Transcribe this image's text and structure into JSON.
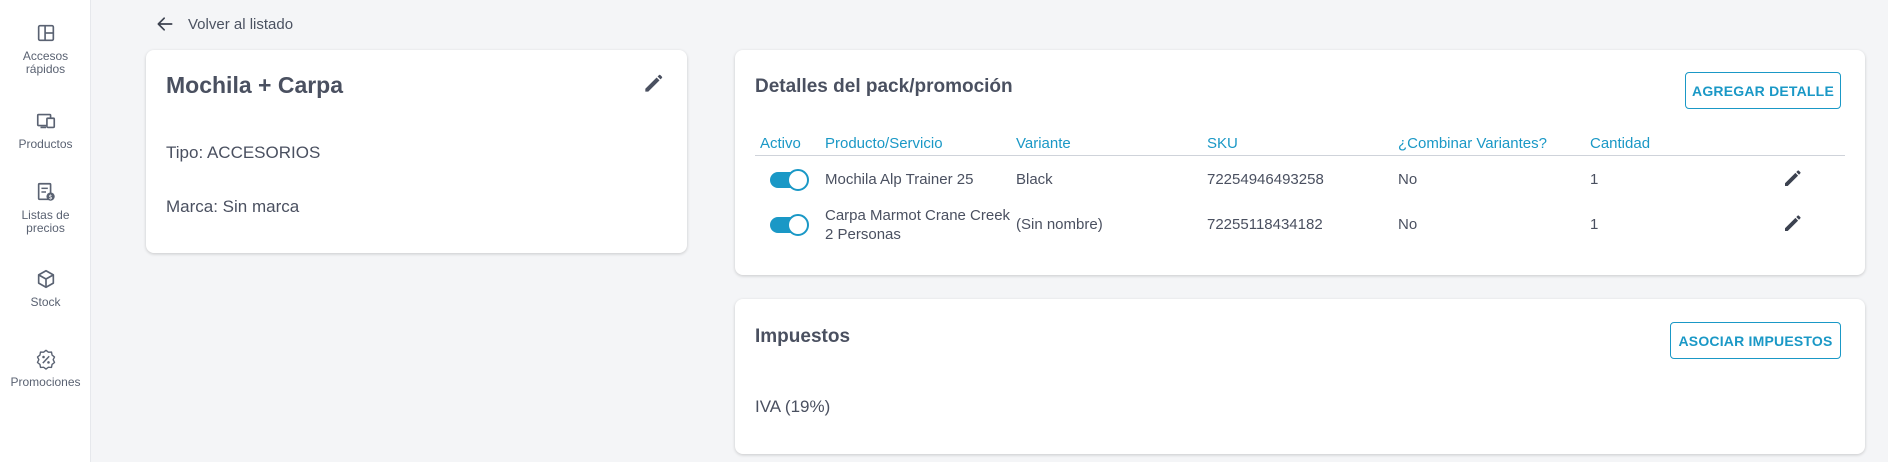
{
  "sidebar": {
    "items": [
      {
        "label_lines": [
          "Accesos",
          "rápidos"
        ],
        "icon": "dashboard-icon"
      },
      {
        "label_lines": [
          "Productos"
        ],
        "icon": "devices-icon"
      },
      {
        "label_lines": [
          "Listas de",
          "precios"
        ],
        "icon": "price-list-icon"
      },
      {
        "label_lines": [
          "Stock"
        ],
        "icon": "cube-icon"
      },
      {
        "label_lines": [
          "Promociones"
        ],
        "icon": "discount-icon"
      }
    ]
  },
  "back": {
    "label": "Volver al listado",
    "icon": "arrow-left-icon"
  },
  "product": {
    "title": "Mochila + Carpa",
    "tipo": "Tipo: ACCESORIOS",
    "marca": "Marca: Sin marca"
  },
  "pack": {
    "title": "Detalles del pack/promoción",
    "add_button": "AGREGAR DETALLE",
    "columns": [
      "Activo",
      "Producto/Servicio",
      "Variante",
      "SKU",
      "¿Combinar Variantes?",
      "Cantidad"
    ],
    "rows": [
      {
        "active": true,
        "producto": "Mochila Alp Trainer 25",
        "producto_line2": "",
        "variante": "Black",
        "sku": "72254946493258",
        "combinar": "No",
        "cantidad": "1"
      },
      {
        "active": true,
        "producto": "Carpa Marmot Crane Creek",
        "producto_line2": "2 Personas",
        "variante": "(Sin nombre)",
        "sku": "72255118434182",
        "combinar": "No",
        "cantidad": "1"
      }
    ]
  },
  "taxes": {
    "title": "Impuestos",
    "button": "ASOCIAR IMPUESTOS",
    "value": "IVA (19%)"
  },
  "colors": {
    "accent": "#1a98c6",
    "text": "#4a5060",
    "background": "#f4f5f7"
  }
}
